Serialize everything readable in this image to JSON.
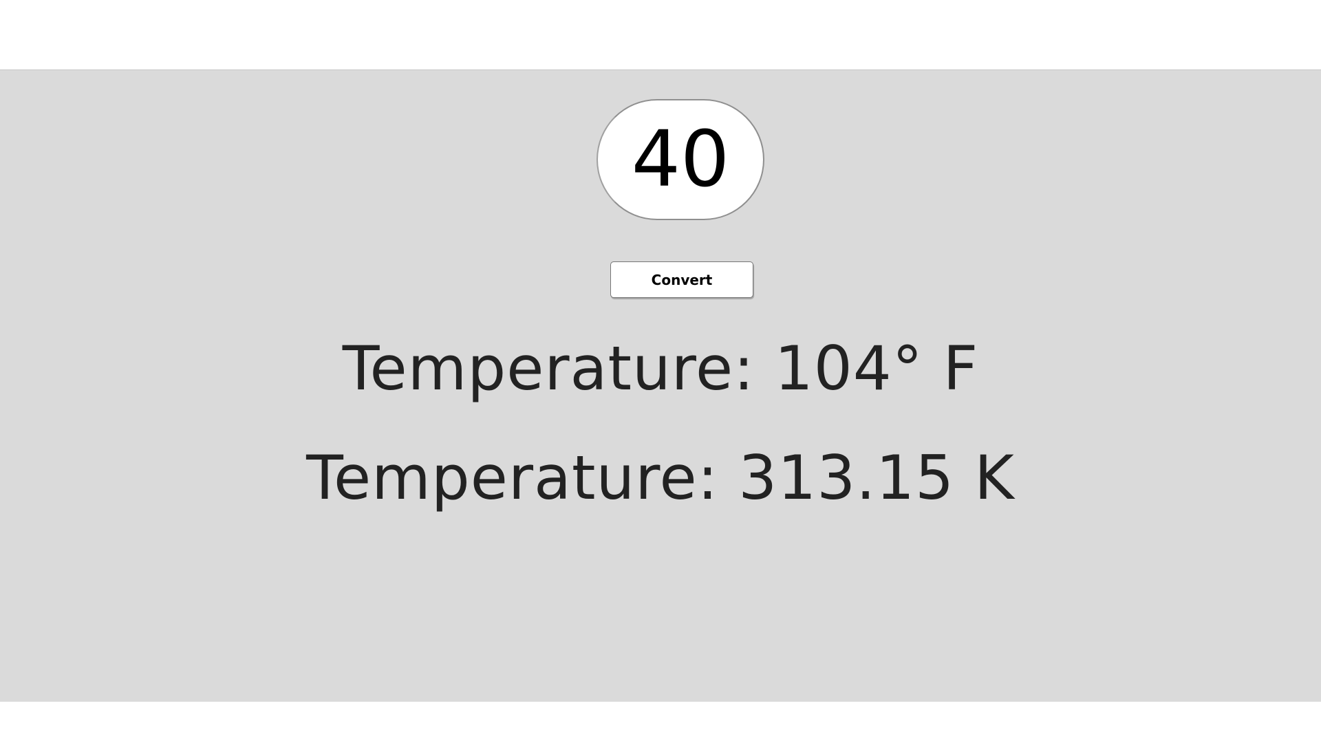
{
  "converter": {
    "input_value": "40",
    "convert_label": "Convert"
  },
  "results": {
    "fahrenheit_text": "Temperature: 104° F",
    "kelvin_text": "Temperature: 313.15 K"
  },
  "colors": {
    "panel_background": "#dadada",
    "page_background": "#ffffff",
    "text": "#222222"
  }
}
